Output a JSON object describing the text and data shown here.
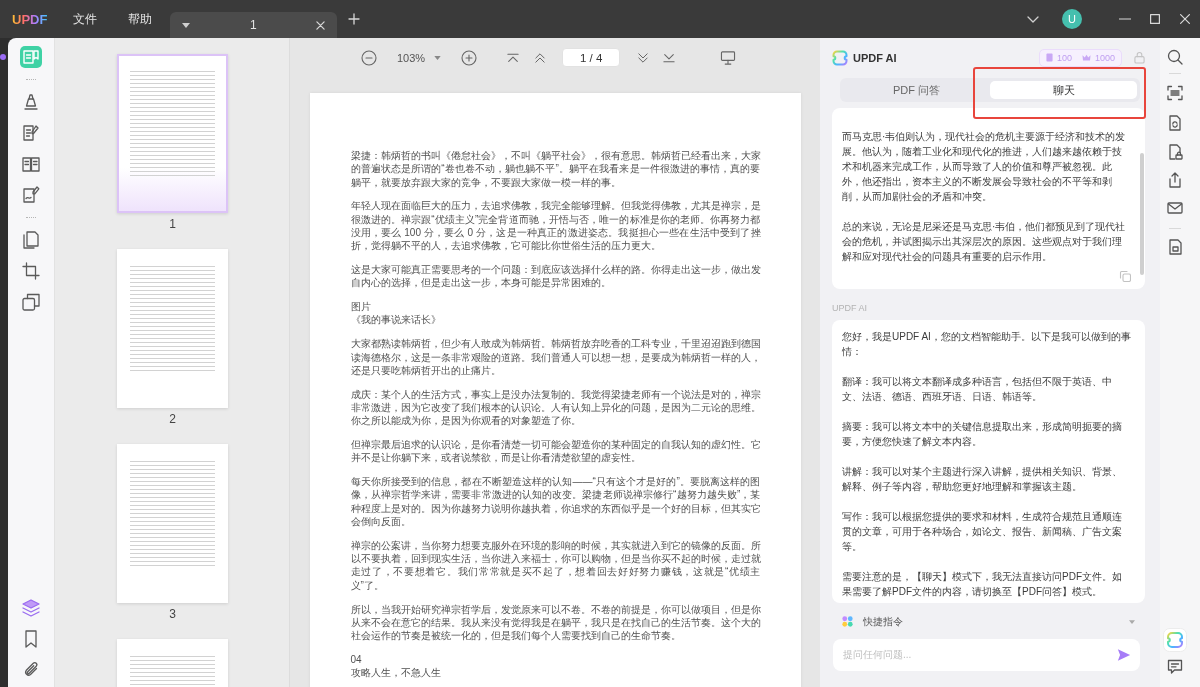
{
  "title_bar": {
    "logo": "UPDF",
    "menus": [
      "文件",
      "帮助"
    ],
    "tabs": [
      {
        "title": "1",
        "selected": true
      }
    ],
    "avatar": "U"
  },
  "left_toolbar": {
    "tool_groups": [
      [
        {
          "kind": "reader",
          "selected": true
        }
      ],
      [
        {
          "kind": "comment",
          "selected": false
        },
        {
          "kind": "edit",
          "selected": false
        },
        {
          "kind": "form",
          "selected": false
        },
        {
          "kind": "sign",
          "selected": false
        }
      ],
      [
        {
          "kind": "organize",
          "selected": false
        },
        {
          "kind": "crop",
          "selected": false
        },
        {
          "kind": "tools",
          "selected": false
        }
      ]
    ],
    "bottom_tools": [
      {
        "kind": "layers",
        "selected": false
      },
      {
        "kind": "bookmark",
        "selected": false
      },
      {
        "kind": "attachment",
        "selected": false
      }
    ]
  },
  "thumbnails": [
    {
      "label": "1",
      "selected": true
    },
    {
      "label": "2",
      "selected": false
    },
    {
      "label": "3",
      "selected": false
    },
    {
      "selected": false
    }
  ],
  "page_toolbar": {
    "zoom": "103%",
    "page": "1 / 4"
  },
  "document": {
    "paragraphs": [
      [
        "梁捷：韩炳哲的书叫《倦怠社会》，不叫《躺平社会》，很有意思。韩炳哲已经看出来，大家的普遍状态是所谓的“卷也卷不动，躺也躺不平”。躺平在我看来是一件很激进的事情，真的要躺平，就要放弃跟大家的竞争，不要跟大家做一模一样的事。"
      ],
      [
        "年轻人现在面临巨大的压力，去追求佛教，我完全能够理解。但我觉得佛教，尤其是禅宗，是很激进的。禅宗跟“优绩主义”完全背道而驰，开悟与否，唯一的标准是你的老师。你再努力都没用，要么 100 分，要么 0 分，这是一种真正的激进姿态。我挺担心一些在生活中受到了挫折，觉得躺不平的人，去追求佛教，它可能比你世俗生活的压力更大。"
      ],
      [
        "这是大家可能真正需要思考的一个问题：到底应该选择什么样的路。你得走出这一步，做出发自内心的选择，但是走出这一步，本身可能是异常困难的。"
      ],
      [
        "图片",
        "《我的事说来话长》"
      ],
      [
        "大家都熟读韩炳哲，但少有人敢成为韩炳哲。韩炳哲放弃吃香的工科专业，千里迢迢跑到德国读海德格尔，这是一条非常艰险的道路。我们普通人可以想一想，是要成为韩炳哲一样的人，还是只要吃韩炳哲开出的止痛片。"
      ],
      [
        "成庆：某个人的生活方式，事实上是没办法复制的。我觉得梁捷老师有一个说法是对的，禅宗非常激进，因为它改变了我们根本的认识论。人有认知上异化的问题，是因为二元论的思维。你之所以能成为你，是因为你观看的对象塑造了你。"
      ],
      [
        "但禅宗最后追求的认识论，是你看清楚一切可能会塑造你的某种固定的自我认知的虚幻性。它并不是让你躺下来，或者说禁欲，而是让你看清楚欲望的虚妄性。"
      ],
      [
        "每天你所接受到的信息，都在不断塑造这样的认知——“只有这个才是好的”。要脱离这样的图像，从禅宗哲学来讲，需要非常激进的认知的改变。梁捷老师说禅宗修行“越努力越失败”，某种程度上是对的。因为你越努力说明你越执着，你追求的东西似乎是一个好的目标，但其实它会倒向反面。"
      ],
      [
        "禅宗的公案讲，当你努力想要克服外在环境的影响的时候，其实就进入到它的镜像的反面。所以不要执着，回到现实生活，当你进入来福士，你可以购物，但是当你买不起的时候，走过就走过了，不要想着它。我们常常就是买不起了，想着回去好好努力赚钱，这就是“优绩主义”了。"
      ],
      [
        "所以，当我开始研究禅宗哲学后，发觉原来可以不卷。不卷的前提是，你可以做项目，但是你从来不会在意它的结果。我从来没有觉得我是在躺平，我只是在找自己的生活节奏。这个大的社会运作的节奏是被统一化的，但是我们每个人需要找到自己的生命节奏。"
      ],
      [
        "04",
        "攻略人生，不急人生"
      ]
    ]
  },
  "ai_panel": {
    "title": "UPDF AI",
    "credits": [
      {
        "kind": "document",
        "value": "100"
      },
      {
        "kind": "premium",
        "value": "1000"
      }
    ],
    "tabs": [
      {
        "label": "PDF 问答",
        "selected": false,
        "highlighted": false
      },
      {
        "label": "聊天",
        "selected": true,
        "highlighted": true
      }
    ],
    "messages": [
      {
        "paragraphs": [
          "而马克思·韦伯则认为，现代社会的危机主要源于经济和技术的发展。他认为，随着工业化和现代化的推进，人们越来越依赖于技术和机器来完成工作，从而导致了人的价值和尊严被忽视。此外，他还指出，资本主义的不断发展会导致社会的不平等和剥削，从而加剧社会的矛盾和冲突。",
          "总的来说，无论是尼采还是马克思·韦伯，他们都预见到了现代社会的危机，并试图揭示出其深层次的原因。这些观点对于我们理解和应对现代社会的问题具有重要的启示作用。"
        ]
      },
      {
        "sender": "UPDF AI",
        "paragraphs": [
          "您好，我是UPDF AI，您的文档智能助手。以下是我可以做到的事情：",
          "翻译：我可以将文本翻译成多种语言，包括但不限于英语、中文、法语、德语、西班牙语、日语、韩语等。",
          "摘要：我可以将文本中的关键信息提取出来，形成简明扼要的摘要，方便您快速了解文本内容。",
          "讲解：我可以对某个主题进行深入讲解，提供相关知识、背景、解释、例子等内容，帮助您更好地理解和掌握该主题。",
          "写作：我可以根据您提供的要求和材料，生成符合规范且通顺连贯的文章，可用于各种场合，如论文、报告、新闻稿、广告文案等。",
          "需要注意的是，【聊天】模式下，我无法直接访问PDF文件。如果需要了解PDF文件的内容，请切换至【PDF问答】模式。"
        ]
      }
    ],
    "quick_commands": "快捷指令",
    "input": {
      "placeholder": "提问任何问题..."
    }
  }
}
